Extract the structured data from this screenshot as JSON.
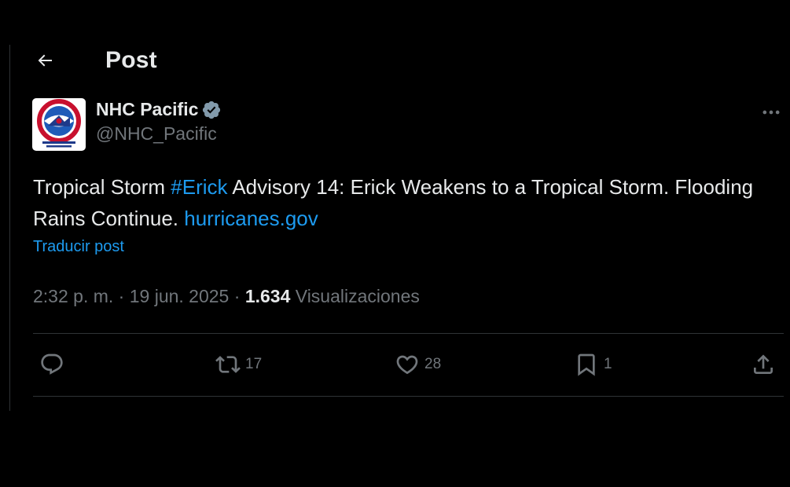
{
  "header": {
    "title": "Post",
    "back_icon": "arrow-left-icon"
  },
  "author": {
    "name": "NHC Pacific",
    "handle": "@NHC_Pacific",
    "verified_icon": "verified-badge-icon",
    "avatar_icon": "national-weather-service-logo-icon",
    "avatar_logo_text": "NATIONAL WEATHER SERVICE · National Hurricane Center"
  },
  "post": {
    "text_before": "Tropical Storm ",
    "hashtag": "#Erick",
    "text_middle": " Advisory 14: Erick Weakens to a Tropical Storm. Flooding Rains Continue. ",
    "url": "hurricanes.gov",
    "translate_label": "Traducir post"
  },
  "meta": {
    "time": "2:32 p. m.",
    "separator": " · ",
    "date": "19 jun. 2025",
    "views_count": "1.634",
    "views_label": " Visualizaciones"
  },
  "actions": {
    "reply": {
      "icon": "reply-icon",
      "count": ""
    },
    "repost": {
      "icon": "repost-icon",
      "count": "17"
    },
    "like": {
      "icon": "heart-icon",
      "count": "28"
    },
    "bookmark": {
      "icon": "bookmark-icon",
      "count": "1"
    },
    "share": {
      "icon": "share-icon"
    }
  },
  "more_icon": "more-options-icon",
  "colors": {
    "background": "#000000",
    "text_primary": "#e7e9ea",
    "text_secondary": "#71767b",
    "accent_link": "#1d9bf0",
    "divider": "#2f3336",
    "verified_badge": "#829aab"
  }
}
